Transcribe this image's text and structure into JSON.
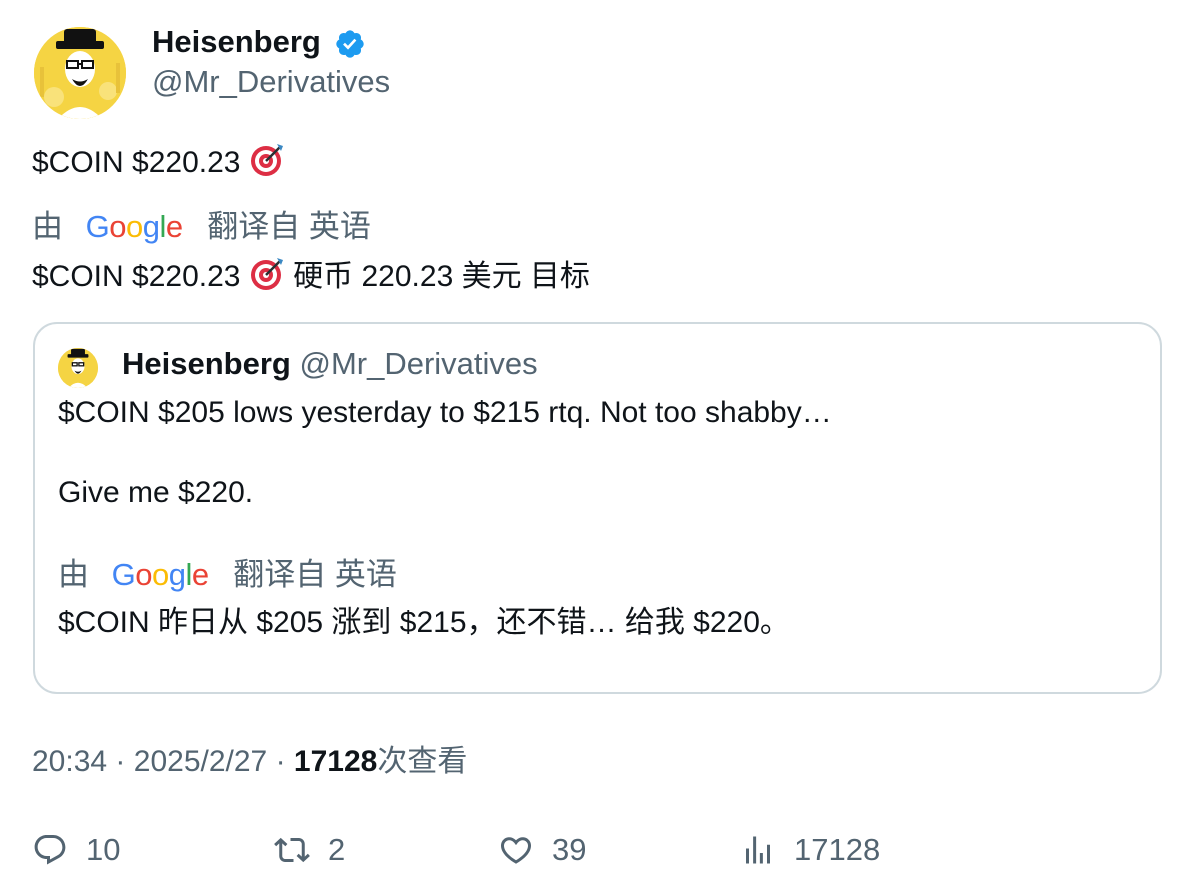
{
  "author": {
    "name": "Heisenberg",
    "handle": "@Mr_Derivatives",
    "verified_icon": "verified-badge-icon"
  },
  "tweet": {
    "text_prefix": "$COIN $220.23",
    "emoji": "direct-hit-target-icon",
    "translation_label_by": "由",
    "translation_brand": [
      "G",
      "o",
      "o",
      "g",
      "l",
      "e"
    ],
    "translation_label_from": "翻译自 英语",
    "translated_prefix": "$COIN $220.23",
    "translated_suffix": "硬币 220.23 美元 目标"
  },
  "quote": {
    "name": "Heisenberg",
    "handle": "@Mr_Derivatives",
    "line1": "$COIN $205 lows yesterday to $215 rtq. Not too shabby…",
    "line2": "Give me $220.",
    "translation_label_by": "由",
    "translation_label_from": "翻译自 英语",
    "translated_text": "$COIN 昨日从 $205 涨到 $215，还不错… 给我 $220。"
  },
  "meta": {
    "time": "20:34",
    "sep": "·",
    "date": "2025/2/27",
    "views_number": "17128",
    "views_label": "次查看"
  },
  "actions": {
    "replies": "10",
    "retweets": "2",
    "likes": "39",
    "views": "17128"
  },
  "colors": {
    "text": "#0f1419",
    "secondary": "#536471",
    "verified": "#1d9bf0",
    "border": "#cfd9de",
    "avatar_bg": "#f5d443"
  }
}
